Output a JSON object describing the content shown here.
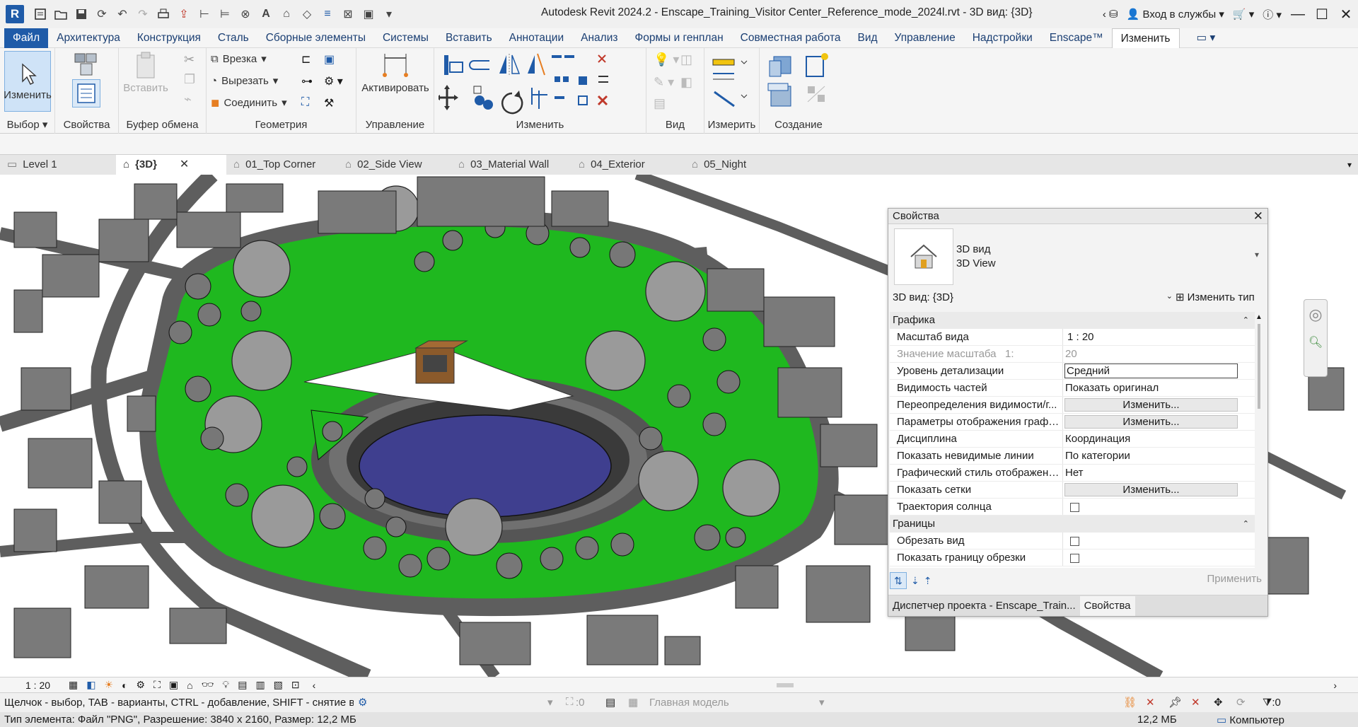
{
  "app": {
    "logo_letter": "R",
    "title": "Autodesk Revit 2024.2 - Enscape_Training_Visitor Center_Reference_mode_2024l.rvt - 3D вид: {3D}",
    "signin": "Вход в службы"
  },
  "menu": {
    "tabs": [
      "Файл",
      "Архитектура",
      "Конструкция",
      "Сталь",
      "Сборные элементы",
      "Системы",
      "Вставить",
      "Аннотации",
      "Анализ",
      "Формы и генплан",
      "Совместная работа",
      "Вид",
      "Управление",
      "Надстройки",
      "Enscape™",
      "Изменить"
    ]
  },
  "ribbon": {
    "select": {
      "button_label": "Изменить",
      "panel_title": "Выбор"
    },
    "properties": {
      "panel_title": "Свойства"
    },
    "clipboard": {
      "paste_label": "Вставить",
      "panel_title": "Буфер обмена"
    },
    "geometry": {
      "cut_label": "Врезка",
      "cutout_label": "Вырезать",
      "join_label": "Соединить",
      "panel_title": "Геометрия"
    },
    "control": {
      "activate_label": "Активировать",
      "panel_title": "Управление"
    },
    "modify": {
      "panel_title": "Изменить"
    },
    "view": {
      "panel_title": "Вид"
    },
    "measure": {
      "panel_title": "Измерить"
    },
    "create": {
      "panel_title": "Создание"
    }
  },
  "view_tabs": [
    {
      "label": "Level 1",
      "icon": "floor-plan-icon"
    },
    {
      "label": "{3D}",
      "icon": "house-icon",
      "active": true
    },
    {
      "label": "01_Top Corner",
      "icon": "house-icon"
    },
    {
      "label": "02_Side View",
      "icon": "house-icon"
    },
    {
      "label": "03_Material Wall",
      "icon": "house-icon"
    },
    {
      "label": "04_Exterior",
      "icon": "house-icon"
    },
    {
      "label": "05_Night",
      "icon": "house-icon"
    }
  ],
  "properties_panel": {
    "title": "Свойства",
    "type_line1": "3D вид",
    "type_line2": "3D View",
    "selector_value": "3D вид: {3D}",
    "edit_type": "Изменить тип",
    "groups": {
      "graphics": "Графика",
      "extents": "Границы"
    },
    "rows": {
      "view_scale": {
        "name": "Масштаб вида",
        "value": "1 : 20"
      },
      "scale_value": {
        "name": "Значение масштаба",
        "suffix": "1:",
        "value": "20"
      },
      "detail_level": {
        "name": "Уровень детализации",
        "value": "Средний"
      },
      "parts_visibility": {
        "name": "Видимость частей",
        "value": "Показать оригинал"
      },
      "vg_overrides": {
        "name": "Переопределения видимости/г...",
        "value": "Изменить..."
      },
      "graphic_display": {
        "name": "Параметры отображения графи...",
        "value": "Изменить..."
      },
      "discipline": {
        "name": "Дисциплина",
        "value": "Координация"
      },
      "hidden_lines": {
        "name": "Показать невидимые линии",
        "value": "По категории"
      },
      "graphic_style": {
        "name": "Графический стиль отображени...",
        "value": "Нет"
      },
      "show_grids": {
        "name": "Показать сетки",
        "value": "Изменить..."
      },
      "sun_path": {
        "name": "Траектория солнца",
        "checked": false
      },
      "crop_view": {
        "name": "Обрезать вид",
        "checked": false
      },
      "crop_region": {
        "name": "Показать границу обрезки",
        "checked": false
      }
    },
    "apply": "Применить",
    "bottom_tabs": [
      "Диспетчер проекта - Enscape_Train...",
      "Свойства"
    ]
  },
  "view_control": {
    "scale": "1 : 20"
  },
  "status": {
    "message": "Щелчок - выбор, TAB - варианты, CTRL - добавление, SHIFT - снятие вы",
    "sel_count": ":0",
    "model": "Главная модель",
    "filter_count": ":0"
  },
  "info": {
    "element": "Тип элемента: Файл \"PNG\", Разрешение: 3840 x 2160, Размер: 12,2 МБ",
    "size": "12,2 МБ",
    "computer": "Компьютер"
  },
  "colors": {
    "accent": "#1f5ba8",
    "grass": "#1fb81f",
    "water": "#3f3f8f",
    "building": "#7a7a7a",
    "road": "#5e5e5e"
  }
}
